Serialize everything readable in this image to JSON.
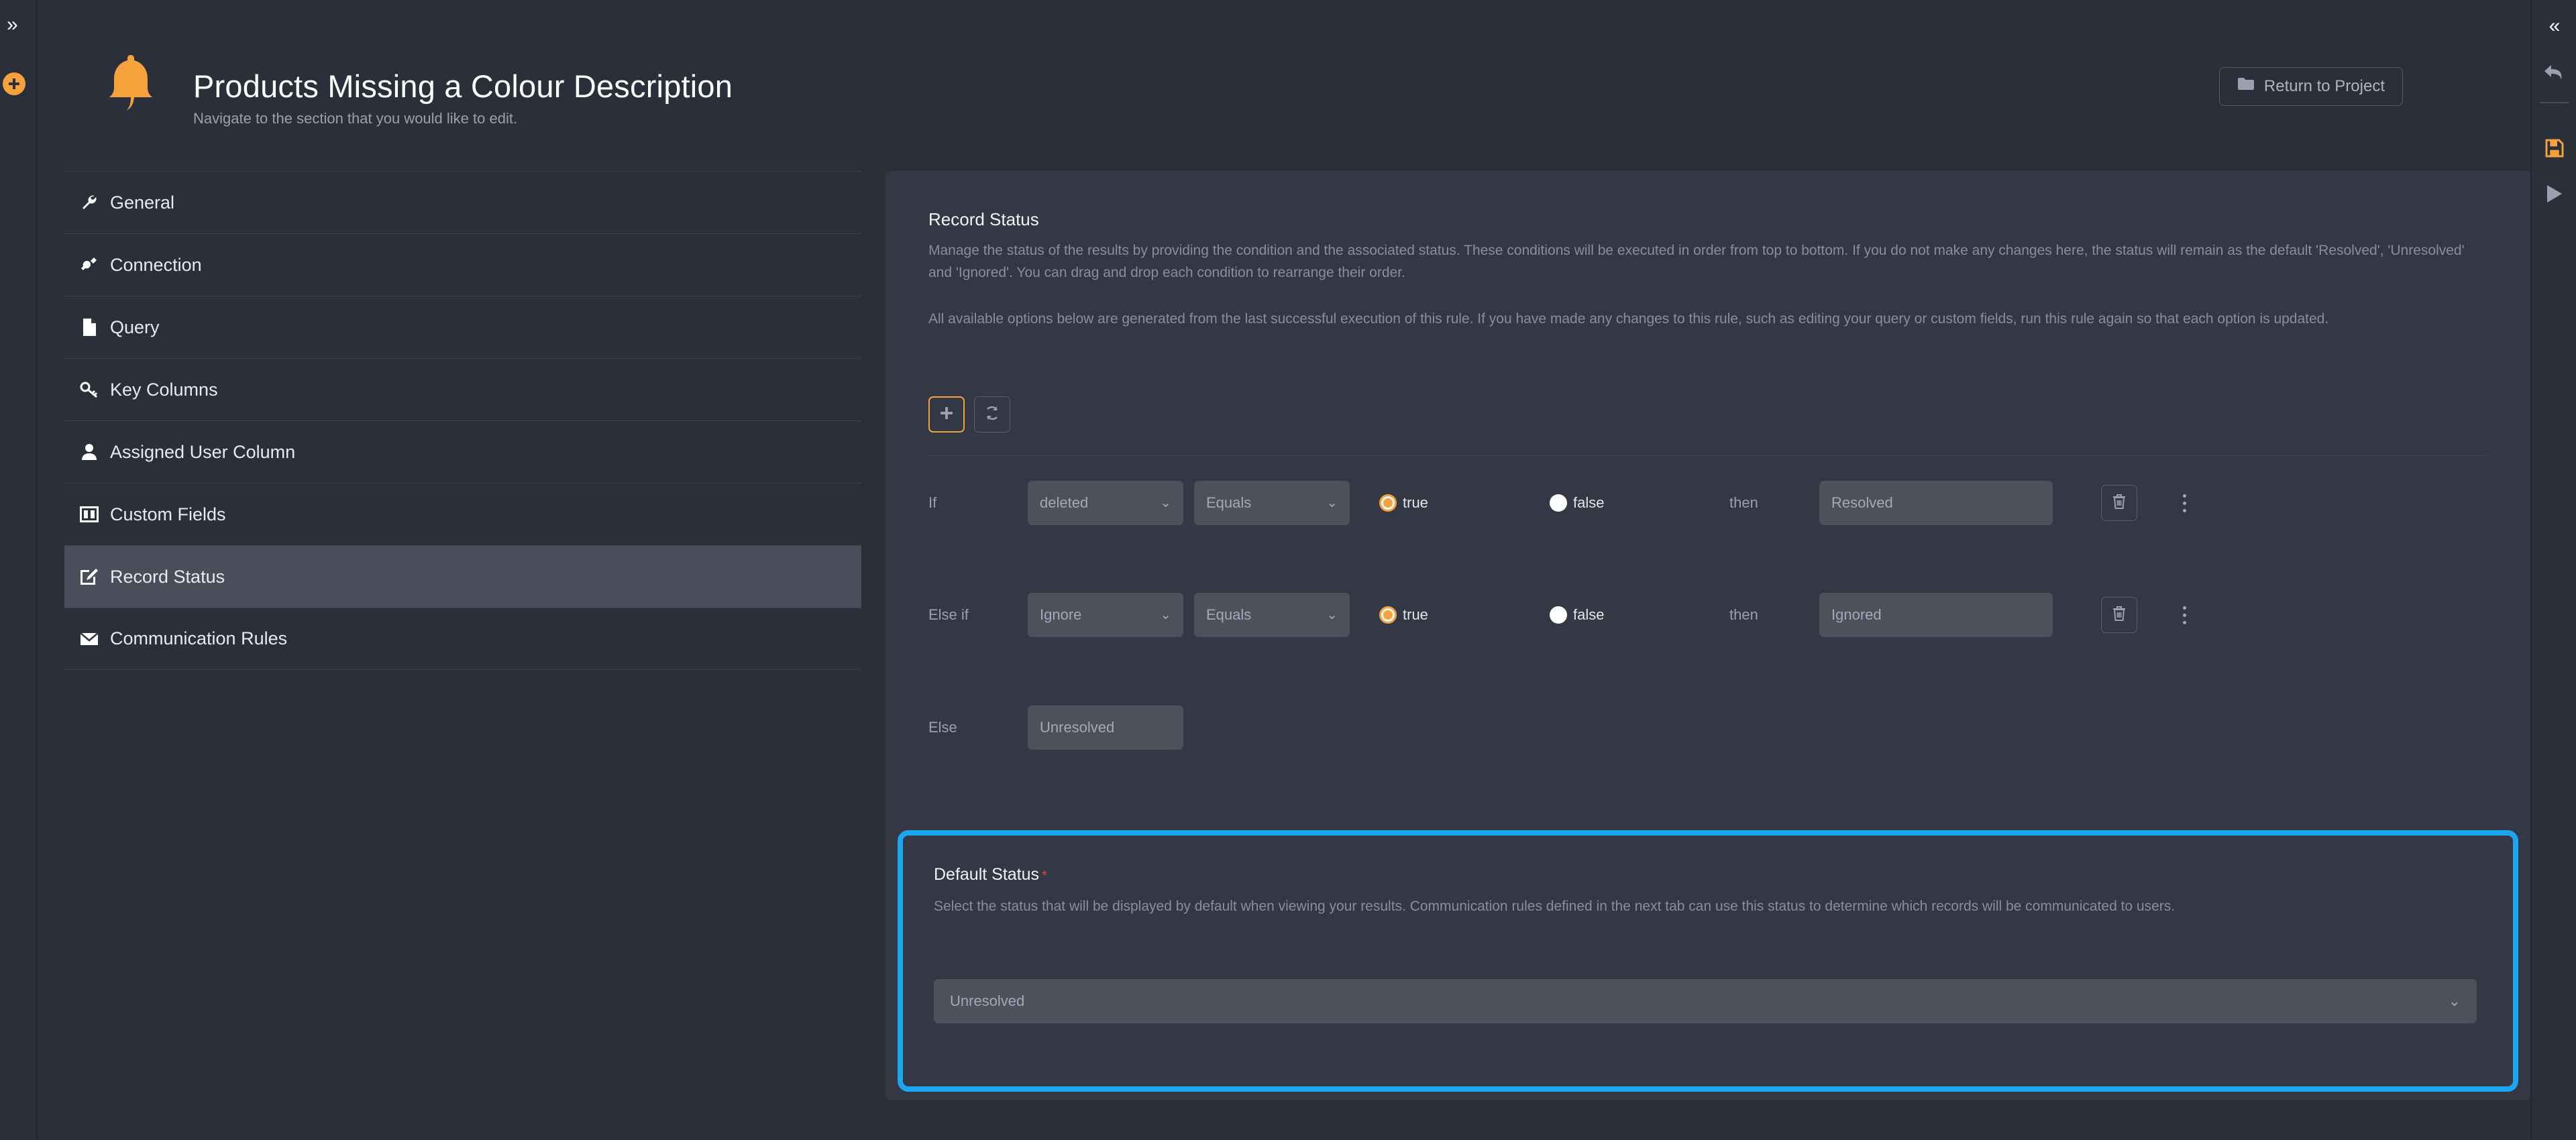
{
  "left_rail": {
    "expand_icon": "chevron-double-right-icon",
    "add_icon": "circle-plus-icon"
  },
  "right_rail": {
    "collapse_icon": "chevron-double-left-icon",
    "undo_icon": "undo-arrow-icon",
    "save_icon": "floppy-save-icon",
    "run_icon": "play-triangle-icon",
    "accent_color": "#f5a23c"
  },
  "header": {
    "logo_icon": "bell-icon",
    "title": "Products Missing a Colour Description",
    "subtitle": "Navigate to the section that you would like to edit.",
    "return_button": {
      "label": "Return to Project",
      "icon": "folder-icon"
    }
  },
  "sidebar": {
    "items": [
      {
        "label": "General",
        "icon": "wrench-icon",
        "active": false
      },
      {
        "label": "Connection",
        "icon": "plug-icon",
        "active": false
      },
      {
        "label": "Query",
        "icon": "file-icon",
        "active": false
      },
      {
        "label": "Key Columns",
        "icon": "key-icon",
        "active": false
      },
      {
        "label": "Assigned User Column",
        "icon": "user-icon",
        "active": false
      },
      {
        "label": "Custom Fields",
        "icon": "columns-icon",
        "active": false
      },
      {
        "label": "Record Status",
        "icon": "edit-square-icon",
        "active": true
      },
      {
        "label": "Communication Rules",
        "icon": "envelope-icon",
        "active": false
      }
    ]
  },
  "main": {
    "section_title": "Record Status",
    "description_1": "Manage the status of the results by providing the condition and the associated status. These conditions will be executed in order from top to bottom. If you do not make any changes here, the status will remain as the default 'Resolved', 'Unresolved' and 'Ignored'. You can drag and drop each condition to rearrange their order.",
    "description_2": "All available options below are generated from the last successful execution of this rule. If you have made any changes to this rule, such as editing your query or custom fields, run this rule again so that each option is updated.",
    "toolbar": {
      "add_icon": "plus-icon",
      "refresh_icon": "refresh-icon"
    },
    "conditions": [
      {
        "prefix": "If",
        "field": "deleted",
        "operator": "Equals",
        "true_label": "true",
        "false_label": "false",
        "selected_value": "true",
        "then_label": "then",
        "status": "Resolved",
        "delete_icon": "trash-icon",
        "menu_icon": "kebab-menu-icon"
      },
      {
        "prefix": "Else if",
        "field": "Ignore",
        "operator": "Equals",
        "true_label": "true",
        "false_label": "false",
        "selected_value": "true",
        "then_label": "then",
        "status": "Ignored",
        "delete_icon": "trash-icon",
        "menu_icon": "kebab-menu-icon"
      }
    ],
    "else_row": {
      "prefix": "Else",
      "status": "Unresolved"
    },
    "default_status": {
      "title": "Default Status",
      "required_marker": "*",
      "description": "Select the status that will be displayed by default when viewing your results. Communication rules defined in the next tab can use this status to determine which records will be communicated to users.",
      "value": "Unresolved",
      "caret_icon": "chevron-down-icon",
      "highlight_color": "#1aa7f0"
    }
  }
}
